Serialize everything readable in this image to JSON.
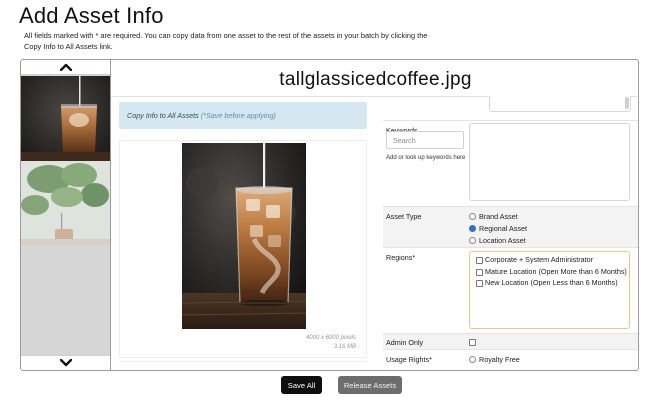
{
  "page": {
    "title": "Add Asset Info",
    "intro": "All fields marked with * are required. You can copy data from one asset to the rest of the assets in your batch by clicking the Copy Info to All Assets link."
  },
  "thumbnails": {
    "up_icon": "chevron-up-icon",
    "down_icon": "chevron-down-icon",
    "items": [
      {
        "alt": "iced coffee thumbnail",
        "selected": true
      },
      {
        "alt": "plant and cup thumbnail",
        "selected": false
      }
    ]
  },
  "asset": {
    "filename": "tallglassicedcoffee.jpg",
    "copy_link": "Copy Info to All Assets",
    "copy_note": "(*Save before applying)",
    "dimensions": "4000 x 6000 pixels",
    "size": "3.16 MB"
  },
  "form": {
    "keywords": {
      "label": "Keywords",
      "placeholder": "Search",
      "help": "Add or look up keywords here"
    },
    "asset_type": {
      "label": "Asset Type",
      "options": [
        {
          "label": "Brand Asset",
          "checked": false
        },
        {
          "label": "Regional Asset",
          "checked": true
        },
        {
          "label": "Location Asset",
          "checked": false
        }
      ]
    },
    "regions": {
      "label": "Regions*",
      "options": [
        {
          "label": "Corporate + System Administrator",
          "checked": false
        },
        {
          "label": "Mature Location (Open More than 6 Months)",
          "checked": false
        },
        {
          "label": "New Location (Open Less than 6 Months)",
          "checked": false
        }
      ]
    },
    "admin_only": {
      "label": "Admin Only",
      "checked": false
    },
    "usage_rights": {
      "label": "Usage Rights*",
      "options": [
        {
          "label": "Royalty Free",
          "checked": false
        }
      ]
    }
  },
  "buttons": {
    "save_all": "Save All",
    "release_assets": "Release Assets"
  },
  "colors": {
    "copy_box_bg": "#d5e8f1",
    "regions_border": "#f0c48a",
    "radio_checked": "#2e72c9",
    "save_button": "#0e0e0e",
    "release_button": "#6d6d6d"
  }
}
